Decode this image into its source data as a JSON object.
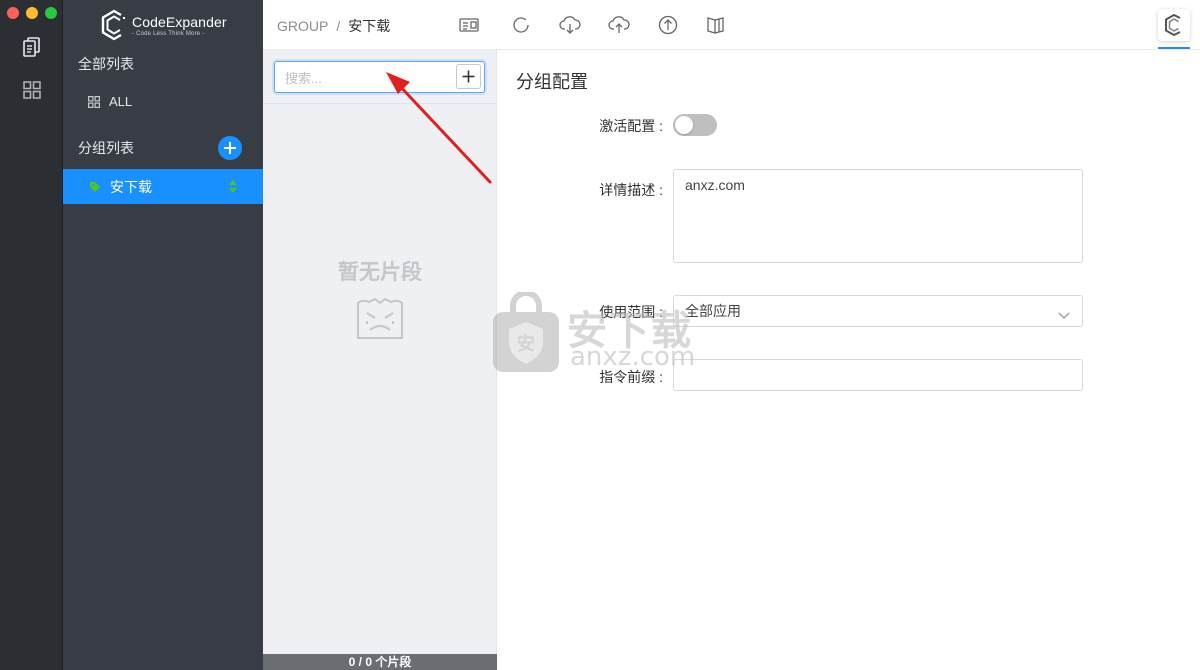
{
  "window": {
    "traffic_lights": [
      "close",
      "minimize",
      "maximize"
    ]
  },
  "activity_bar": {
    "icons": [
      "snippets-icon",
      "grid-icon"
    ]
  },
  "sidebar": {
    "logo": {
      "name": "CodeExpander",
      "slogan": "- Code Less Think More -"
    },
    "all_list": {
      "title": "全部列表",
      "items": [
        {
          "label": "ALL",
          "icon": "grid-icon"
        }
      ]
    },
    "group_list": {
      "title": "分组列表",
      "add_icon": "plus-circle-icon",
      "items": [
        {
          "label": "安下载",
          "selected": true,
          "icon": "tag-icon"
        }
      ]
    },
    "colors": {
      "background": "#383d45",
      "selected": "#1890ff"
    }
  },
  "header": {
    "breadcrumb": {
      "root": "GROUP",
      "separator": "/",
      "current": "安下载"
    },
    "tools": [
      "id-card-icon",
      "circle-icon",
      "cloud-download-icon",
      "cloud-upload-icon",
      "arrow-up-circle-icon",
      "book-icon"
    ],
    "app_logo_icon": "codeexpander-logo-icon"
  },
  "snippet_list": {
    "search": {
      "placeholder": "搜索...",
      "value": ""
    },
    "empty_title": "暂无片段",
    "empty_icon": "empty-face-icon",
    "footer": "0 / 0 个片段"
  },
  "form": {
    "title": "分组配置",
    "activate": {
      "label": "激活配置 :",
      "enabled": false
    },
    "description": {
      "label": "详情描述 :",
      "value": "anxz.com"
    },
    "scope": {
      "label": "使用范围 :",
      "value": "全部应用"
    },
    "prefix": {
      "label": "指令前缀 :",
      "value": ""
    }
  },
  "watermark": {
    "text": "安下载",
    "domain": "anxz.com",
    "icon": "shield-icon"
  },
  "annotation": {
    "type": "arrow",
    "color": "#e02020"
  }
}
